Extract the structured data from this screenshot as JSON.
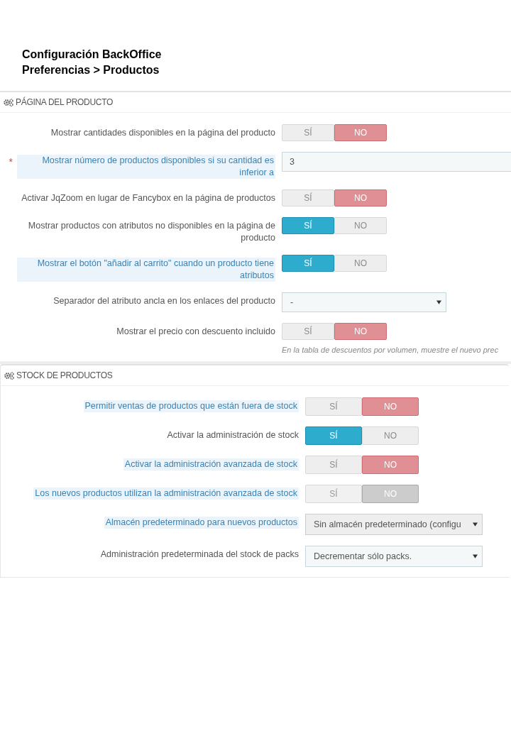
{
  "page_title": [
    "Configuración BackOffice",
    "Preferencias > Productos"
  ],
  "panels": [
    {
      "title": "PÁGINA DEL PRODUCTO",
      "rows": [
        {
          "kind": "toggle",
          "label": "Mostrar cantidades disponibles en la página del producto",
          "help": false,
          "yes": "SÍ",
          "no": "NO",
          "on": false,
          "disabled": false
        },
        {
          "kind": "input",
          "label": "Mostrar número de productos disponibles si su cantidad es inferior a",
          "help": true,
          "required_mark": "*",
          "value": "3"
        },
        {
          "kind": "toggle",
          "label": "Activar JqZoom en lugar de Fancybox en la página de productos",
          "help": false,
          "yes": "SÍ",
          "no": "NO",
          "on": false,
          "disabled": false
        },
        {
          "kind": "toggle",
          "label": "Mostrar productos con atributos no disponibles en la página de producto",
          "help": false,
          "yes": "SÍ",
          "no": "NO",
          "on": true,
          "disabled": false
        },
        {
          "kind": "toggle",
          "label": "Mostrar el botón \"añadir al carrito\" cuando un producto tiene atributos",
          "help": true,
          "yes": "SÍ",
          "no": "NO",
          "on": true,
          "disabled": false
        },
        {
          "kind": "select",
          "label": "Separador del atributo ancla en los enlaces del producto",
          "help": false,
          "value": "-",
          "disabled": false
        },
        {
          "kind": "toggle",
          "label": "Mostrar el precio con descuento incluido",
          "help": false,
          "yes": "SÍ",
          "no": "NO",
          "on": false,
          "disabled": false,
          "hint": "En la tabla de descuentos por volumen, muestre el nuevo prec"
        }
      ]
    },
    {
      "title": "STOCK DE PRODUCTOS",
      "rows": [
        {
          "kind": "toggle",
          "label": "Permitir ventas de productos que están fuera de stock",
          "help": true,
          "yes": "SÍ",
          "no": "NO",
          "on": false,
          "disabled": false
        },
        {
          "kind": "toggle",
          "label": "Activar la administración de stock",
          "help": false,
          "yes": "SÍ",
          "no": "NO",
          "on": true,
          "disabled": false
        },
        {
          "kind": "toggle",
          "label": "Activar la administración avanzada de stock",
          "help": true,
          "yes": "SÍ",
          "no": "NO",
          "on": false,
          "disabled": false
        },
        {
          "kind": "toggle",
          "label": "Los nuevos productos utilizan la administración avanzada de stock",
          "help": true,
          "yes": "SÍ",
          "no": "NO",
          "on": false,
          "disabled": true
        },
        {
          "kind": "select",
          "label": "Almacén predeterminado para nuevos productos",
          "help": true,
          "value": "Sin almacén predeterminado (configu",
          "disabled": true
        },
        {
          "kind": "select",
          "label": "Administración predeterminada del stock de packs",
          "help": false,
          "value": "Decrementar sólo packs.",
          "disabled": false
        }
      ]
    }
  ]
}
